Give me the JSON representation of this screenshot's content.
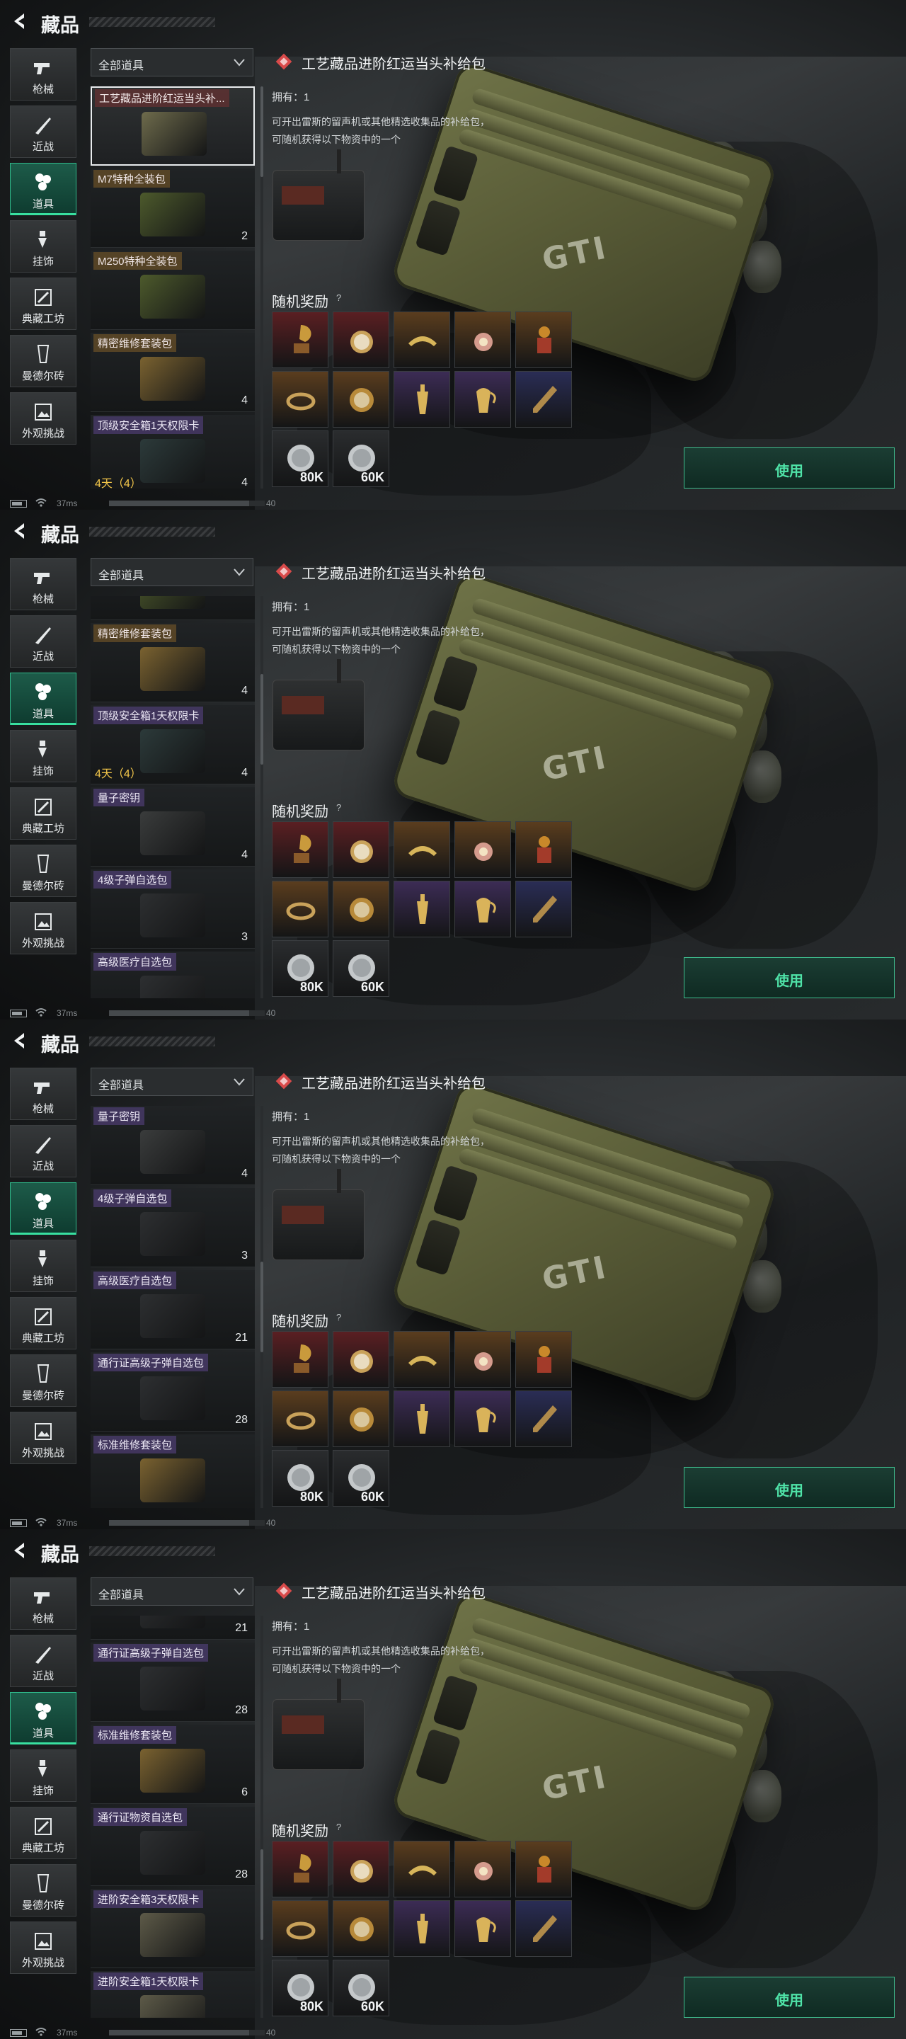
{
  "page_title": "藏品",
  "nav": [
    {
      "label": "枪械",
      "icon": "gun-icon"
    },
    {
      "label": "近战",
      "icon": "knife-icon"
    },
    {
      "label": "道具",
      "icon": "items-icon",
      "active": true
    },
    {
      "label": "挂饰",
      "icon": "charm-icon"
    },
    {
      "label": "典藏工坊",
      "icon": "workshop-icon"
    },
    {
      "label": "曼德尔砖",
      "icon": "mandel-brick-icon"
    },
    {
      "label": "外观挑战",
      "icon": "appearance-challenge-icon"
    }
  ],
  "filter": {
    "label": "全部道具"
  },
  "detail": {
    "title": "工艺藏品进阶红运当头补给包",
    "owned": "拥有：1",
    "description": "可开出雷斯的留声机或其他精选收集品的补给包，可随机获得以下物资中的一个",
    "reward_label": "随机奖励",
    "help": "?",
    "use_label": "使用"
  },
  "rewards": [
    {
      "icon": "gramophone-icon",
      "bg": "#5a1f22"
    },
    {
      "icon": "pocket-watch-icon",
      "bg": "#5a1f22"
    },
    {
      "icon": "tiara-icon",
      "bg": "#5a3d1e"
    },
    {
      "icon": "medal-icon",
      "bg": "#5a3d1e"
    },
    {
      "icon": "figurine-icon",
      "bg": "#5a3d1e"
    },
    {
      "icon": "bracelet-icon",
      "bg": "#5a3d1e"
    },
    {
      "icon": "gold-watch-icon",
      "bg": "#5a3d1e"
    },
    {
      "icon": "perfume-bottle-icon",
      "bg": "#3c2c55"
    },
    {
      "icon": "ewer-icon",
      "bg": "#3c2c55"
    },
    {
      "icon": "pen-icon",
      "bg": "#2a2d55"
    },
    {
      "icon": "coin-icon",
      "bg": "#2a2c2e",
      "amount": "80K"
    },
    {
      "icon": "coin-icon",
      "bg": "#2a2c2e",
      "amount": "60K"
    }
  ],
  "status": {
    "ping": "37ms",
    "progress_fraction": 0.9,
    "progress_number": "40"
  },
  "frames": [
    {
      "scroll_fraction": 0.0,
      "items": [
        {
          "name": "工艺藏品进阶红运当头补...",
          "count": "",
          "style": "red",
          "selected": true,
          "thumb": "#6e6b4c"
        },
        {
          "name": "M7特种全装包",
          "count": "2",
          "style": "gold",
          "thumb": "#4d5a2c"
        },
        {
          "name": "M250特种全装包",
          "count": "",
          "style": "gold",
          "thumb": "#4d5a2c"
        },
        {
          "name": "精密维修套装包",
          "count": "4",
          "style": "gold",
          "thumb": "#7a6230"
        },
        {
          "name": "顶级安全箱1天权限卡",
          "count": "4",
          "style": "purple",
          "timer": "4天（4）",
          "thumb": "#2c3a3a"
        }
      ]
    },
    {
      "scroll_fraction": 0.25,
      "items": [
        {
          "name": "",
          "count": "",
          "style": "gold",
          "thumb": "#4d5a2c",
          "partial": true
        },
        {
          "name": "精密维修套装包",
          "count": "4",
          "style": "gold",
          "thumb": "#7a6230"
        },
        {
          "name": "顶级安全箱1天权限卡",
          "count": "4",
          "style": "purple",
          "timer": "4天（4）",
          "thumb": "#2c3a3a"
        },
        {
          "name": "量子密钥",
          "count": "4",
          "style": "purple",
          "thumb": "#3a3c3c"
        },
        {
          "name": "4级子弹自选包",
          "count": "3",
          "style": "purple",
          "thumb": "#2d2f31"
        },
        {
          "name": "高级医疗自选包",
          "count": "",
          "style": "purple",
          "thumb": "#2d2f31"
        }
      ]
    },
    {
      "scroll_fraction": 0.5,
      "items": [
        {
          "name": "量子密钥",
          "count": "4",
          "style": "purple",
          "thumb": "#3a3c3c"
        },
        {
          "name": "4级子弹自选包",
          "count": "3",
          "style": "purple",
          "thumb": "#2d2f31"
        },
        {
          "name": "高级医疗自选包",
          "count": "21",
          "style": "purple",
          "thumb": "#2d2f31"
        },
        {
          "name": "通行证高级子弹自选包",
          "count": "28",
          "style": "purple",
          "thumb": "#2d2f31"
        },
        {
          "name": "标准维修套装包",
          "count": "",
          "style": "purple",
          "thumb": "#7a6230"
        }
      ]
    },
    {
      "scroll_fraction": 0.75,
      "items": [
        {
          "name": "",
          "count": "21",
          "style": "purple",
          "thumb": "#2d2f31",
          "partial": true
        },
        {
          "name": "通行证高级子弹自选包",
          "count": "28",
          "style": "purple",
          "thumb": "#2d2f31"
        },
        {
          "name": "标准维修套装包",
          "count": "6",
          "style": "purple",
          "thumb": "#7a6230"
        },
        {
          "name": "通行证物资自选包",
          "count": "28",
          "style": "purple",
          "thumb": "#2d2f31"
        },
        {
          "name": "进阶安全箱3天权限卡",
          "count": "",
          "style": "purple",
          "thumb": "#5d5a48"
        },
        {
          "name": "进阶安全箱1天权限卡",
          "count": "",
          "style": "purple",
          "thumb": "#5d5a48"
        }
      ]
    }
  ]
}
